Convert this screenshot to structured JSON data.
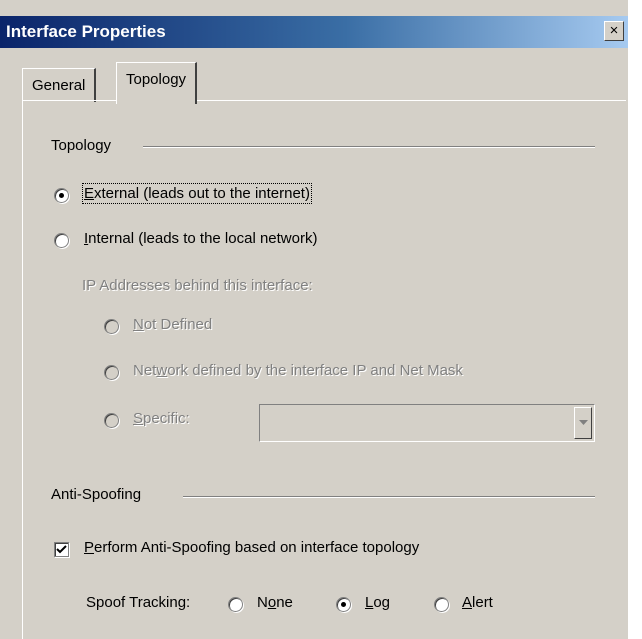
{
  "window": {
    "title": "Interface Properties",
    "close_glyph": "×",
    "close_icon": "close-icon"
  },
  "tabs": [
    {
      "label": "General",
      "active": false
    },
    {
      "label": "Topology",
      "active": true
    }
  ],
  "topology": {
    "group_label": "Topology",
    "external": {
      "label_u": "E",
      "label_rest": "xternal (leads out to the internet)",
      "checked": true
    },
    "internal": {
      "label_u": "I",
      "label_rest": "nternal (leads to the local network)",
      "checked": false
    },
    "ip_heading": "IP Addresses behind this interface:",
    "not_defined": {
      "label_u": "N",
      "label_rest": "ot Defined",
      "enabled": false
    },
    "network_defined": {
      "label_pre": "Net",
      "label_u": "w",
      "label_rest": "ork defined by the interface IP and Net Mask",
      "enabled": false
    },
    "specific": {
      "label_u": "S",
      "label_rest": "pecific:",
      "enabled": false,
      "value": ""
    }
  },
  "anti_spoofing": {
    "group_label": "Anti-Spoofing",
    "perform": {
      "label_u": "P",
      "label_rest": "erform Anti-Spoofing based on interface topology",
      "checked": true
    },
    "tracking_label": "Spoof Tracking:",
    "none": {
      "label_pre": "N",
      "label_u": "o",
      "label_rest": "ne",
      "checked": false
    },
    "log": {
      "label_u": "L",
      "label_rest": "og",
      "checked": true
    },
    "alert": {
      "label_u": "A",
      "label_rest": "lert",
      "checked": false
    }
  }
}
